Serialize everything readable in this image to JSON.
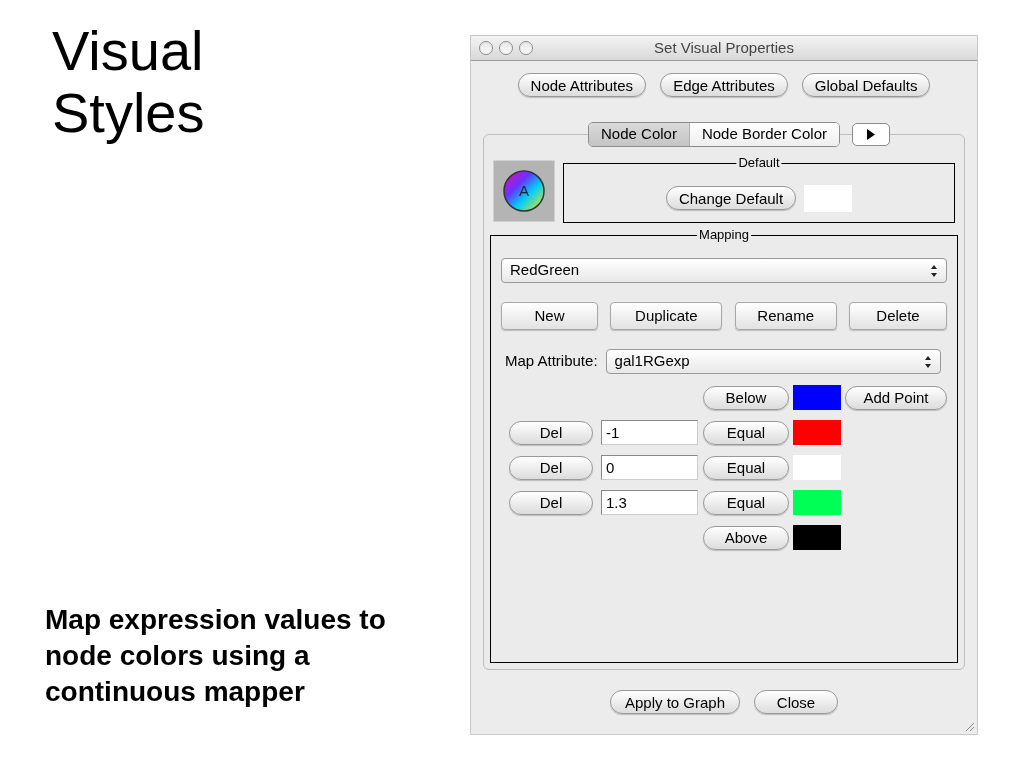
{
  "slide": {
    "title": "Visual Styles",
    "caption": "Map expression values to node colors using a continuous mapper"
  },
  "window": {
    "title": "Set Visual Properties"
  },
  "top_buttons": [
    "Node Attributes",
    "Edge Attributes",
    "Global Defaults"
  ],
  "tabs": [
    {
      "label": "Node Color",
      "selected": true
    },
    {
      "label": "Node Border Color",
      "selected": false
    }
  ],
  "default_group": {
    "icon_letter": "A",
    "title": "Default",
    "button": "Change Default",
    "color": "#ffffff"
  },
  "mapping": {
    "title": "Mapping",
    "mapper": "RedGreen",
    "buttons": [
      "New",
      "Duplicate",
      "Rename",
      "Delete"
    ],
    "map_attribute_label": "Map Attribute:",
    "map_attribute": "gal1RGexp",
    "below": {
      "label": "Below",
      "color": "#0000ff"
    },
    "add_point": "Add Point",
    "points": [
      {
        "delete": "Del",
        "value": "-1",
        "label": "Equal",
        "color": "#ff0000"
      },
      {
        "delete": "Del",
        "value": "0",
        "label": "Equal",
        "color": "#ffffff"
      },
      {
        "delete": "Del",
        "value": "1.3",
        "label": "Equal",
        "color": "#00ff55"
      }
    ],
    "above": {
      "label": "Above",
      "color": "#000000"
    }
  },
  "bottom_buttons": [
    "Apply to Graph",
    "Close"
  ]
}
